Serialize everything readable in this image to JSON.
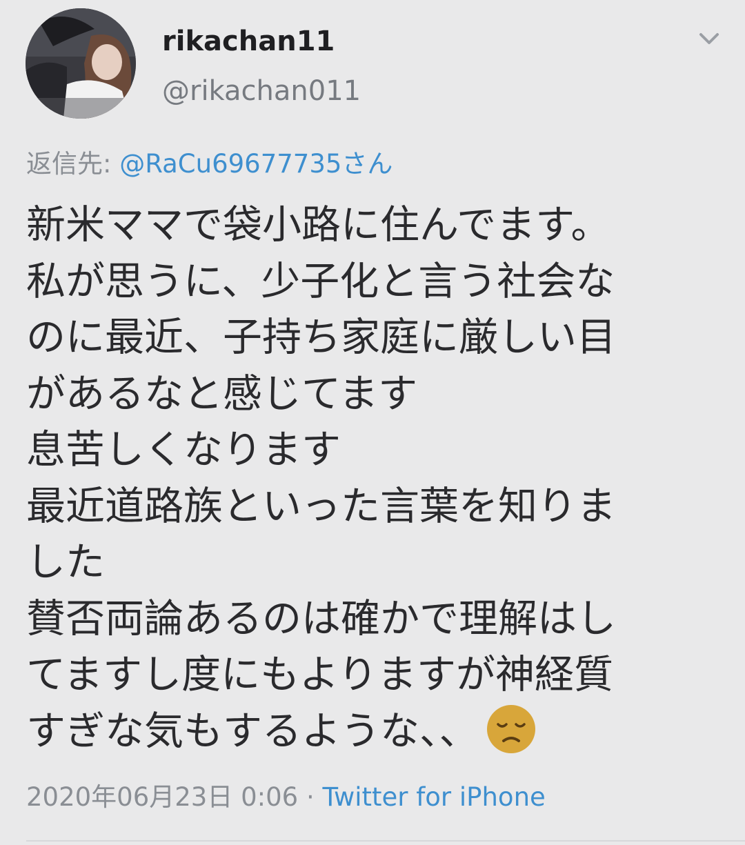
{
  "tweet": {
    "display_name": "rikachan11",
    "handle": "@rikachan011",
    "reply_label": "返信先: ",
    "reply_mention": "@RaCu69677735さん",
    "body_lines": [
      "新米ママで袋小路に住んでます。",
      "私が思うに、少子化と言う社会な",
      "のに最近、子持ち家庭に厳しい目",
      "があるなと感じてます",
      "息苦しくなります",
      "最近道路族といった言葉を知りま",
      "した",
      "賛否両論あるのは確かで理解はし",
      "てますし度にもよりますが神経質",
      "すぎな気もするような、、"
    ],
    "emoji": "disappointed-face",
    "timestamp": "2020年06月23日 0:06",
    "separator": " · ",
    "source": "Twitter for iPhone"
  },
  "icons": {
    "menu": "chevron-down-icon",
    "avatar": "profile-photo"
  },
  "colors": {
    "background": "#e9e9ea",
    "link": "#3e8fcf",
    "secondary_text": "#8a8e94",
    "emoji_face": "#d8a63a"
  }
}
